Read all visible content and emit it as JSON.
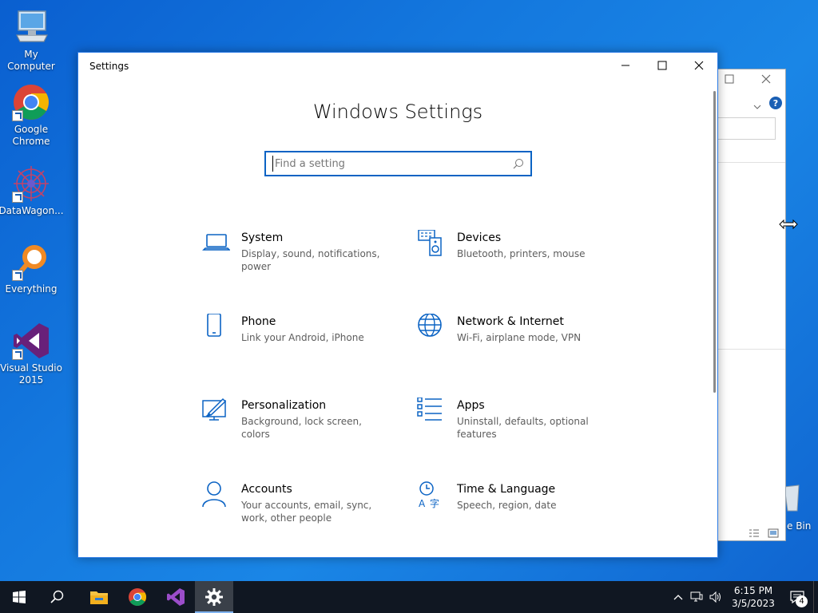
{
  "desktop": {
    "icons": [
      {
        "label": "My Computer",
        "icon": "computer-icon"
      },
      {
        "label": "Google Chrome",
        "icon": "chrome-icon"
      },
      {
        "label": "DataWagon...",
        "icon": "datawagon-icon"
      },
      {
        "label": "Everything",
        "icon": "everything-icon"
      },
      {
        "label": "Visual Studio 2015",
        "icon": "visual-studio-icon"
      }
    ],
    "recycle_bin_label": "e Bin"
  },
  "settings_window": {
    "title": "Settings",
    "heading": "Windows Settings",
    "search_placeholder": "Find a setting",
    "categories": [
      {
        "name": "System",
        "desc": "Display, sound, notifications, power",
        "icon": "laptop-icon"
      },
      {
        "name": "Devices",
        "desc": "Bluetooth, printers, mouse",
        "icon": "keyboard-speaker-icon"
      },
      {
        "name": "Phone",
        "desc": "Link your Android, iPhone",
        "icon": "phone-icon"
      },
      {
        "name": "Network & Internet",
        "desc": "Wi-Fi, airplane mode, VPN",
        "icon": "globe-icon"
      },
      {
        "name": "Personalization",
        "desc": "Background, lock screen, colors",
        "icon": "paint-brush-icon"
      },
      {
        "name": "Apps",
        "desc": "Uninstall, defaults, optional features",
        "icon": "apps-list-icon"
      },
      {
        "name": "Accounts",
        "desc": "Your accounts, email, sync, work, other people",
        "icon": "person-icon"
      },
      {
        "name": "Time & Language",
        "desc": "Speech, region, date",
        "icon": "time-language-icon"
      }
    ]
  },
  "taskbar": {
    "time": "6:15 PM",
    "date": "3/5/2023",
    "notification_count": "4",
    "pinned": [
      "start-icon",
      "search-icon",
      "file-explorer-icon",
      "chrome-icon",
      "visual-studio-icon",
      "settings-gear-icon"
    ]
  },
  "colors": {
    "accent": "#0b63c4",
    "taskbar": "#101722",
    "desktop": "#1478de"
  }
}
